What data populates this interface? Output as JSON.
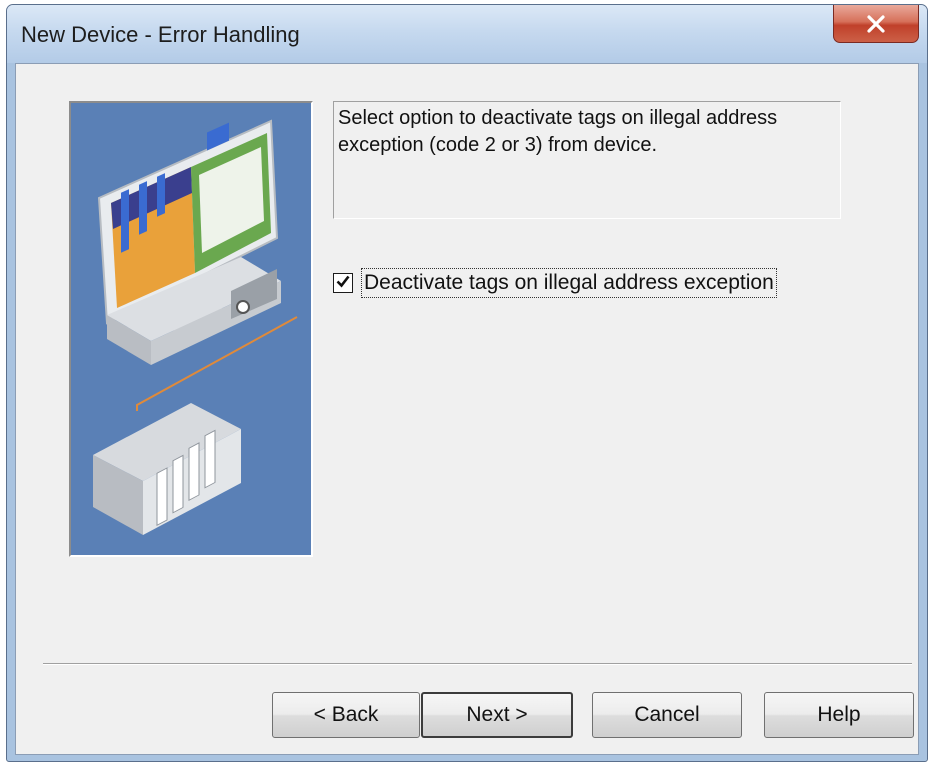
{
  "window": {
    "title": "New Device - Error Handling",
    "close_icon": "close-x-icon"
  },
  "description": {
    "line1": "Select option to deactivate tags on illegal address",
    "line2": "exception (code 2 or 3) from device."
  },
  "option": {
    "label": "Deactivate tags on illegal address exception",
    "checked": true
  },
  "buttons": {
    "back_label": "< Back",
    "next_label": "Next >",
    "cancel_label": "Cancel",
    "help_label": "Help"
  },
  "illustration": {
    "icon": "computer-and-plc-illustration"
  },
  "colors": {
    "illustration_background": "#5a80b6",
    "dialog_background": "#f0f0f0",
    "close_button": "#c0402a"
  }
}
